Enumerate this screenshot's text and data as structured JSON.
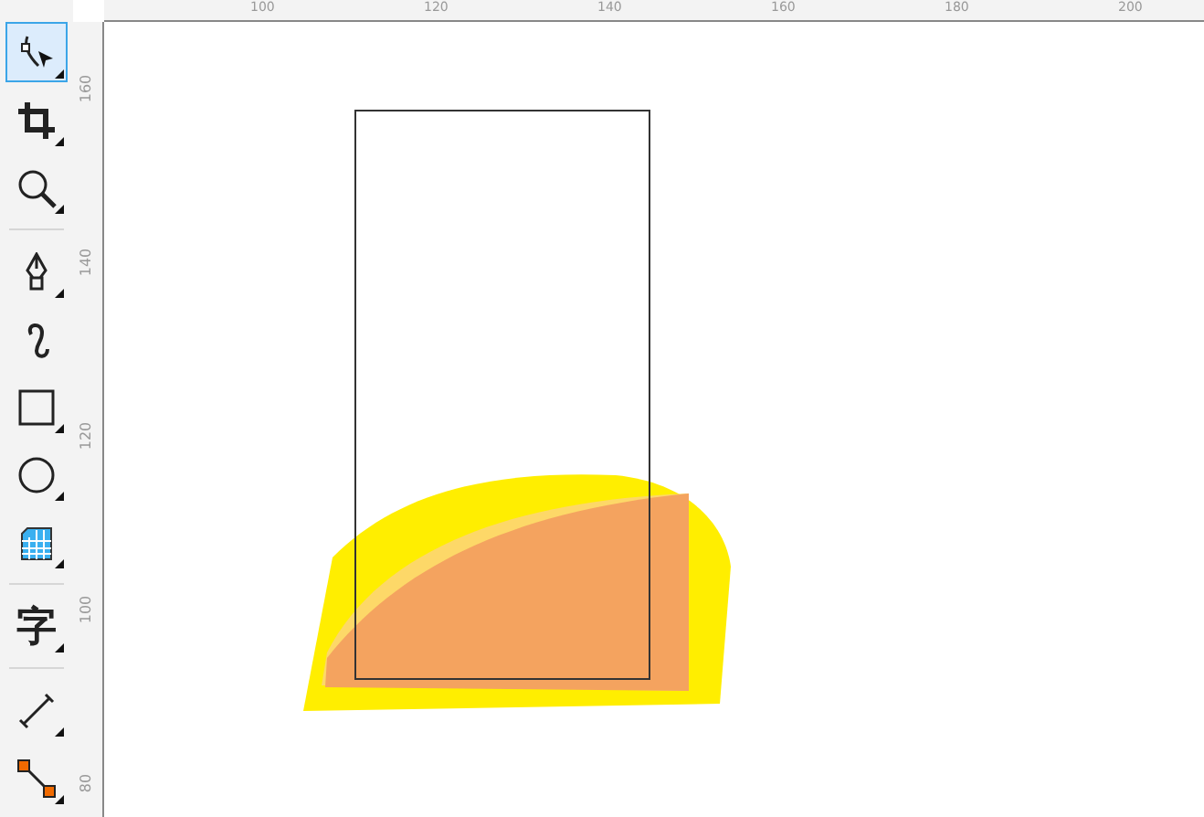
{
  "toolbox": {
    "tools": [
      {
        "kind": "shape",
        "selected": true,
        "flyout": true
      },
      {
        "kind": "crop",
        "selected": false,
        "flyout": true
      },
      {
        "kind": "zoom",
        "selected": false,
        "flyout": true
      },
      {
        "kind": "separator"
      },
      {
        "kind": "pen",
        "selected": false,
        "flyout": true
      },
      {
        "kind": "curve",
        "selected": false,
        "flyout": false
      },
      {
        "kind": "rectangle",
        "selected": false,
        "flyout": true
      },
      {
        "kind": "ellipse",
        "selected": false,
        "flyout": true
      },
      {
        "kind": "table",
        "selected": false,
        "flyout": true
      },
      {
        "kind": "separator"
      },
      {
        "kind": "text",
        "glyph": "字",
        "selected": false,
        "flyout": true
      },
      {
        "kind": "separator"
      },
      {
        "kind": "dimension",
        "selected": false,
        "flyout": true
      },
      {
        "kind": "connector",
        "selected": false,
        "flyout": true
      }
    ]
  },
  "top_ruler": {
    "labels": [
      "100",
      "120",
      "140",
      "160",
      "180",
      "200"
    ]
  },
  "left_ruler": {
    "labels": [
      "160",
      "140",
      "120",
      "100",
      "80"
    ]
  }
}
